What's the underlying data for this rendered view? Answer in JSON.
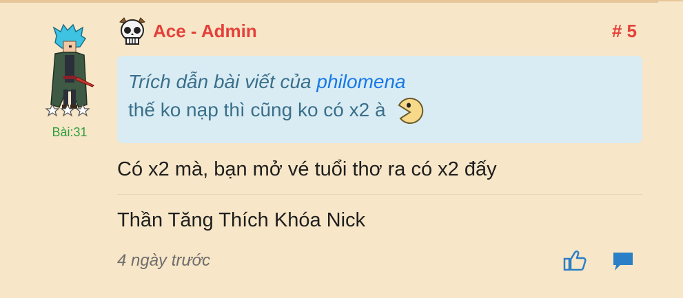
{
  "post": {
    "author": "Ace - Admin",
    "post_number": "# 5",
    "post_count_label": "Bài:31",
    "quote": {
      "prefix": "Trích dẫn bài viết của ",
      "author": "philomena",
      "text": "thế ko nạp thì cũng ko có x2 à"
    },
    "body": "Có x2 mà, bạn mở vé tuổi thơ ra có x2 đấy",
    "signature": "Thần Tăng Thích Khóa Nick",
    "timestamp": "4 ngày trước"
  },
  "icons": {
    "role": "skull-admin-icon",
    "quote_emoji": "pacman-emoji-icon",
    "like": "thumbs-up-icon",
    "reply": "comment-icon"
  },
  "colors": {
    "background": "#f7e6c7",
    "author": "#e5403a",
    "quote_bg": "#d9ecf4",
    "quote_text": "#3a6f8a",
    "quote_author": "#1778e6",
    "post_count": "#2e9e3e",
    "action_icons": "#2a7fc7"
  }
}
